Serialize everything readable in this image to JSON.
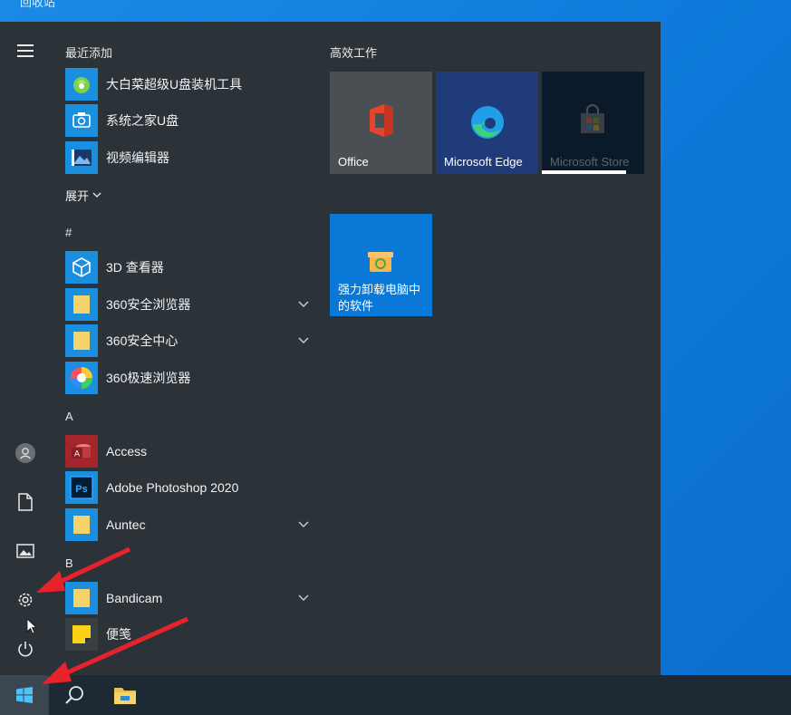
{
  "desktop": {
    "window_title": "回收站"
  },
  "start_menu": {
    "sections": {
      "recent": "最近添加",
      "expand": "展开",
      "hash": "#",
      "a": "A",
      "b": "B"
    },
    "recent_apps": [
      {
        "label": "大白菜超级U盘装机工具"
      },
      {
        "label": "系统之家U盘"
      },
      {
        "label": "视频编辑器"
      }
    ],
    "apps_hash": [
      {
        "label": "3D 查看器"
      },
      {
        "label": "360安全浏览器"
      },
      {
        "label": "360安全中心"
      },
      {
        "label": "360极速浏览器"
      }
    ],
    "apps_a": [
      {
        "label": "Access"
      },
      {
        "label": "Adobe Photoshop 2020"
      },
      {
        "label": "Auntec"
      }
    ],
    "apps_b": [
      {
        "label": "Bandicam"
      },
      {
        "label": "便笺"
      }
    ],
    "tiles_group_title": "高效工作",
    "tiles": [
      {
        "label": "Office",
        "color": "#4a4f54"
      },
      {
        "label": "Microsoft Edge",
        "color": "#1f3b7a"
      },
      {
        "label": "Microsoft Store",
        "color": "#0b1a2a"
      },
      {
        "label": "强力卸载电脑中的软件",
        "label_line1": "强力卸载电脑中",
        "label_line2": "的软件",
        "color": "#0a78d7"
      }
    ]
  },
  "colors": {
    "menu_bg": "#2c3338",
    "accent": "#0a78d7",
    "taskbar": "#1e2a33",
    "annotation_arrow": "#e8222a"
  }
}
